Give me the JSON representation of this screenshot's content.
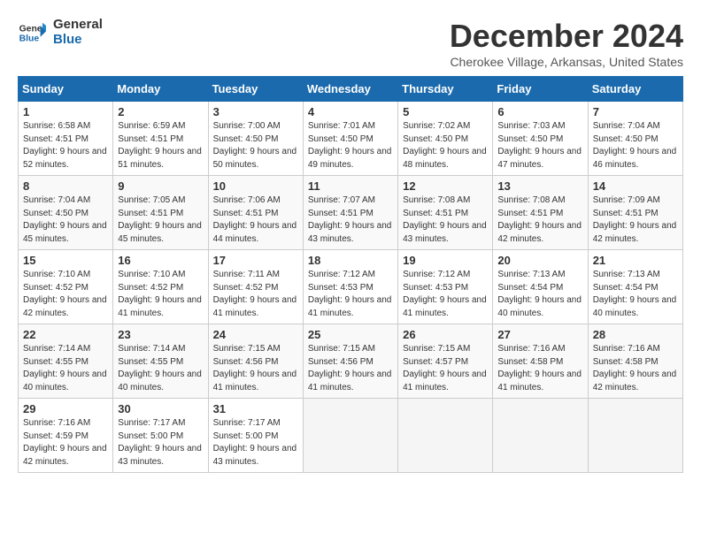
{
  "logo": {
    "line1": "General",
    "line2": "Blue"
  },
  "title": "December 2024",
  "location": "Cherokee Village, Arkansas, United States",
  "days_of_week": [
    "Sunday",
    "Monday",
    "Tuesday",
    "Wednesday",
    "Thursday",
    "Friday",
    "Saturday"
  ],
  "weeks": [
    [
      {
        "day": "1",
        "sunrise": "6:58 AM",
        "sunset": "4:51 PM",
        "daylight": "9 hours and 52 minutes."
      },
      {
        "day": "2",
        "sunrise": "6:59 AM",
        "sunset": "4:51 PM",
        "daylight": "9 hours and 51 minutes."
      },
      {
        "day": "3",
        "sunrise": "7:00 AM",
        "sunset": "4:50 PM",
        "daylight": "9 hours and 50 minutes."
      },
      {
        "day": "4",
        "sunrise": "7:01 AM",
        "sunset": "4:50 PM",
        "daylight": "9 hours and 49 minutes."
      },
      {
        "day": "5",
        "sunrise": "7:02 AM",
        "sunset": "4:50 PM",
        "daylight": "9 hours and 48 minutes."
      },
      {
        "day": "6",
        "sunrise": "7:03 AM",
        "sunset": "4:50 PM",
        "daylight": "9 hours and 47 minutes."
      },
      {
        "day": "7",
        "sunrise": "7:04 AM",
        "sunset": "4:50 PM",
        "daylight": "9 hours and 46 minutes."
      }
    ],
    [
      {
        "day": "8",
        "sunrise": "7:04 AM",
        "sunset": "4:50 PM",
        "daylight": "9 hours and 45 minutes."
      },
      {
        "day": "9",
        "sunrise": "7:05 AM",
        "sunset": "4:51 PM",
        "daylight": "9 hours and 45 minutes."
      },
      {
        "day": "10",
        "sunrise": "7:06 AM",
        "sunset": "4:51 PM",
        "daylight": "9 hours and 44 minutes."
      },
      {
        "day": "11",
        "sunrise": "7:07 AM",
        "sunset": "4:51 PM",
        "daylight": "9 hours and 43 minutes."
      },
      {
        "day": "12",
        "sunrise": "7:08 AM",
        "sunset": "4:51 PM",
        "daylight": "9 hours and 43 minutes."
      },
      {
        "day": "13",
        "sunrise": "7:08 AM",
        "sunset": "4:51 PM",
        "daylight": "9 hours and 42 minutes."
      },
      {
        "day": "14",
        "sunrise": "7:09 AM",
        "sunset": "4:51 PM",
        "daylight": "9 hours and 42 minutes."
      }
    ],
    [
      {
        "day": "15",
        "sunrise": "7:10 AM",
        "sunset": "4:52 PM",
        "daylight": "9 hours and 42 minutes."
      },
      {
        "day": "16",
        "sunrise": "7:10 AM",
        "sunset": "4:52 PM",
        "daylight": "9 hours and 41 minutes."
      },
      {
        "day": "17",
        "sunrise": "7:11 AM",
        "sunset": "4:52 PM",
        "daylight": "9 hours and 41 minutes."
      },
      {
        "day": "18",
        "sunrise": "7:12 AM",
        "sunset": "4:53 PM",
        "daylight": "9 hours and 41 minutes."
      },
      {
        "day": "19",
        "sunrise": "7:12 AM",
        "sunset": "4:53 PM",
        "daylight": "9 hours and 41 minutes."
      },
      {
        "day": "20",
        "sunrise": "7:13 AM",
        "sunset": "4:54 PM",
        "daylight": "9 hours and 40 minutes."
      },
      {
        "day": "21",
        "sunrise": "7:13 AM",
        "sunset": "4:54 PM",
        "daylight": "9 hours and 40 minutes."
      }
    ],
    [
      {
        "day": "22",
        "sunrise": "7:14 AM",
        "sunset": "4:55 PM",
        "daylight": "9 hours and 40 minutes."
      },
      {
        "day": "23",
        "sunrise": "7:14 AM",
        "sunset": "4:55 PM",
        "daylight": "9 hours and 40 minutes."
      },
      {
        "day": "24",
        "sunrise": "7:15 AM",
        "sunset": "4:56 PM",
        "daylight": "9 hours and 41 minutes."
      },
      {
        "day": "25",
        "sunrise": "7:15 AM",
        "sunset": "4:56 PM",
        "daylight": "9 hours and 41 minutes."
      },
      {
        "day": "26",
        "sunrise": "7:15 AM",
        "sunset": "4:57 PM",
        "daylight": "9 hours and 41 minutes."
      },
      {
        "day": "27",
        "sunrise": "7:16 AM",
        "sunset": "4:58 PM",
        "daylight": "9 hours and 41 minutes."
      },
      {
        "day": "28",
        "sunrise": "7:16 AM",
        "sunset": "4:58 PM",
        "daylight": "9 hours and 42 minutes."
      }
    ],
    [
      {
        "day": "29",
        "sunrise": "7:16 AM",
        "sunset": "4:59 PM",
        "daylight": "9 hours and 42 minutes."
      },
      {
        "day": "30",
        "sunrise": "7:17 AM",
        "sunset": "5:00 PM",
        "daylight": "9 hours and 43 minutes."
      },
      {
        "day": "31",
        "sunrise": "7:17 AM",
        "sunset": "5:00 PM",
        "daylight": "9 hours and 43 minutes."
      },
      null,
      null,
      null,
      null
    ]
  ]
}
